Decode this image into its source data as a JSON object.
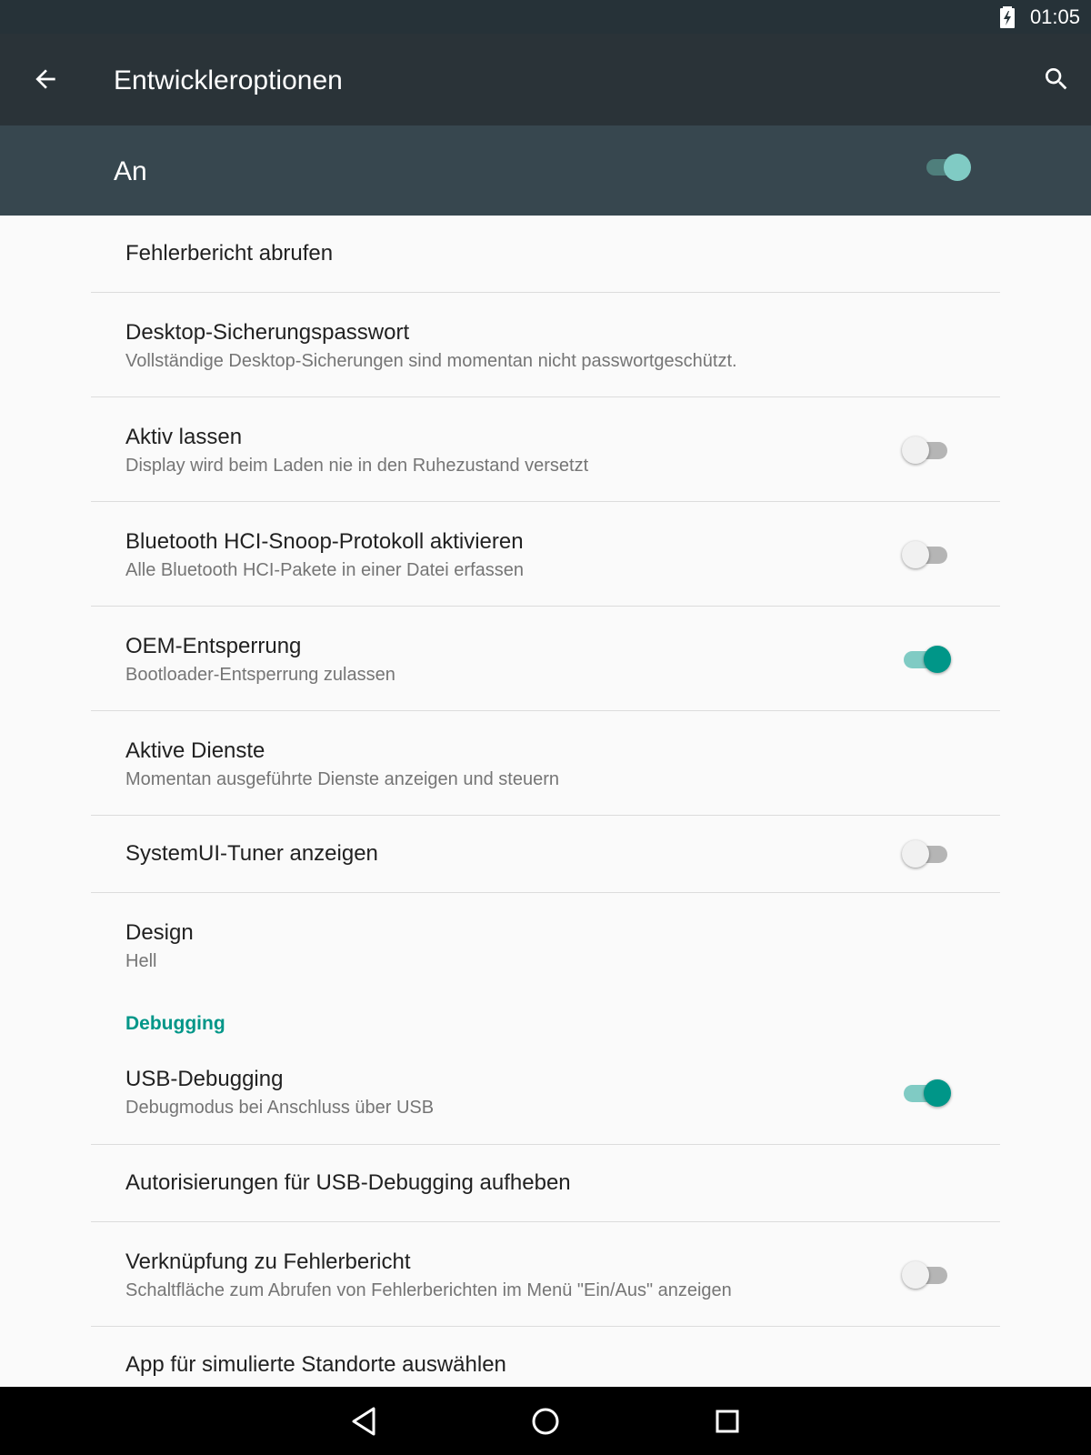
{
  "status_bar": {
    "time": "01:05",
    "battery_icon": "battery-charging-icon"
  },
  "toolbar": {
    "title": "Entwickleroptionen",
    "back_icon": "arrow-back-icon",
    "search_icon": "search-icon"
  },
  "master_switch": {
    "label": "An",
    "on": true
  },
  "items": [
    {
      "title": "Fehlerbericht abrufen"
    },
    {
      "title": "Desktop-Sicherungspasswort",
      "summary": "Vollständige Desktop-Sicherungen sind momentan nicht passwortgeschützt."
    },
    {
      "title": "Aktiv lassen",
      "summary": "Display wird beim Laden nie in den Ruhezustand versetzt",
      "switch_on": false
    },
    {
      "title": "Bluetooth HCI-Snoop-Protokoll aktivieren",
      "summary": "Alle Bluetooth HCI-Pakete in einer Datei erfassen",
      "switch_on": false
    },
    {
      "title": "OEM-Entsperrung",
      "summary": "Bootloader-Entsperrung zulassen",
      "switch_on": true
    },
    {
      "title": "Aktive Dienste",
      "summary": "Momentan ausgeführte Dienste anzeigen und steuern"
    },
    {
      "title": "SystemUI-Tuner anzeigen",
      "switch_on": false
    },
    {
      "title": "Design",
      "summary": "Hell"
    }
  ],
  "debugging": {
    "category": "Debugging",
    "items": [
      {
        "title": "USB-Debugging",
        "summary": "Debugmodus bei Anschluss über USB",
        "switch_on": true
      },
      {
        "title": "Autorisierungen für USB-Debugging aufheben"
      },
      {
        "title": "Verknüpfung zu Fehlerbericht",
        "summary": "Schaltfläche zum Abrufen von Fehlerberichten im Menü \"Ein/Aus\" anzeigen",
        "switch_on": false
      },
      {
        "title": "App für simulierte Standorte auswählen"
      }
    ]
  },
  "nav_bar": {
    "back_icon": "nav-back-icon",
    "home_icon": "nav-home-icon",
    "recents_icon": "nav-recents-icon"
  },
  "colors": {
    "accent": "#009688",
    "toolbar": "#2a3338",
    "master_bar": "#37474f",
    "status_bar": "#263238"
  }
}
